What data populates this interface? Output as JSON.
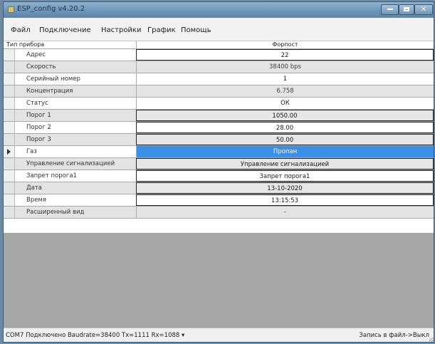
{
  "window": {
    "title": "ESP_config v4.20.2"
  },
  "menu": [
    "Файл",
    "Подключение",
    "Настройки",
    "График",
    "Помощь"
  ],
  "grid": {
    "header": {
      "name": "Тип прибора",
      "value": "Форпост"
    },
    "rows": [
      {
        "name": "Адрес",
        "value": "22",
        "style": "boxed"
      },
      {
        "name": "Скорость",
        "value": "38400 bps",
        "style": "grey"
      },
      {
        "name": "Серийный номер",
        "value": "1",
        "style": "white"
      },
      {
        "name": "Концентрация",
        "value": "6.758",
        "style": "grey"
      },
      {
        "name": "Статус",
        "value": "ОК",
        "style": "white"
      },
      {
        "name": "Порог 1",
        "value": "1050.00",
        "style": "boxed-grey"
      },
      {
        "name": "Порог 2",
        "value": "28.00",
        "style": "boxed"
      },
      {
        "name": "Порог 3",
        "value": "50.00",
        "style": "boxed-grey"
      },
      {
        "name": "Газ",
        "value": "Пропан",
        "style": "selected",
        "current": true
      },
      {
        "name": "Управление сигнализацией",
        "value": "Управление сигнализацией",
        "style": "boxed-grey"
      },
      {
        "name": "Запрет порога1",
        "value": "Запрет порога1",
        "style": "boxed"
      },
      {
        "name": "Дата",
        "value": "13-10-2020",
        "style": "boxed-grey"
      },
      {
        "name": "Время",
        "value": "13:15:53",
        "style": "boxed"
      },
      {
        "name": "Расширенный вид",
        "value": "-",
        "style": "grey"
      }
    ]
  },
  "status": {
    "left": "COM7 Подключено Baudrate=38400 Tx=1111 Rx=1088 ▾",
    "right": "Запись в файл->Выкл"
  },
  "colors": {
    "selection": "#3b8fe6",
    "titlebar": "#6c93b7",
    "empty_area": "#a6a6a6"
  }
}
